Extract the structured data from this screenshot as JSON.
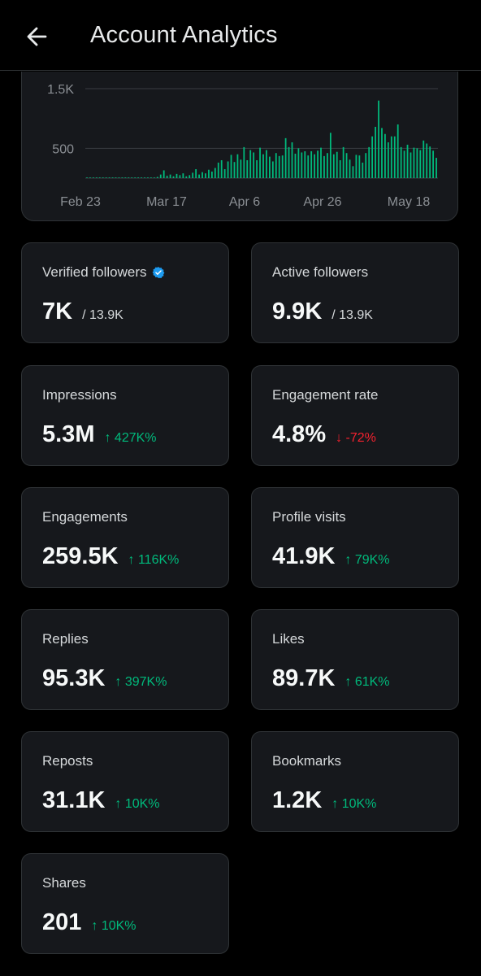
{
  "header": {
    "title": "Account Analytics",
    "back_icon": "arrow-left-icon"
  },
  "chart_data": {
    "type": "bar",
    "ylim": [
      0,
      1500
    ],
    "y_ticks": [
      {
        "value": 500,
        "label": "500"
      },
      {
        "value": 1500,
        "label": "1.5K"
      }
    ],
    "x_ticks": [
      "Feb 23",
      "Mar 17",
      "Apr 6",
      "Apr 26",
      "May 18"
    ],
    "x": [
      "Feb 23",
      "Feb 24",
      "Feb 25",
      "Feb 26",
      "Feb 27",
      "Feb 28",
      "Feb 29",
      "Mar 1",
      "Mar 2",
      "Mar 3",
      "Mar 4",
      "Mar 5",
      "Mar 6",
      "Mar 7",
      "Mar 8",
      "Mar 9",
      "Mar 10",
      "Mar 11",
      "Mar 12",
      "Mar 13",
      "Mar 14",
      "Mar 15",
      "Mar 16",
      "Mar 17",
      "Mar 18",
      "Mar 19",
      "Mar 20",
      "Mar 21",
      "Mar 22",
      "Mar 23",
      "Mar 24",
      "Mar 25",
      "Mar 26",
      "Mar 27",
      "Mar 28",
      "Mar 29",
      "Mar 30",
      "Mar 31",
      "Apr 1",
      "Apr 2",
      "Apr 3",
      "Apr 4",
      "Apr 5",
      "Apr 6",
      "Apr 7",
      "Apr 8",
      "Apr 9",
      "Apr 10",
      "Apr 11",
      "Apr 12",
      "Apr 13",
      "Apr 14",
      "Apr 15",
      "Apr 16",
      "Apr 17",
      "Apr 18",
      "Apr 19",
      "Apr 20",
      "Apr 21",
      "Apr 22",
      "Apr 23",
      "Apr 24",
      "Apr 25",
      "Apr 26",
      "Apr 27",
      "Apr 28",
      "Apr 29",
      "Apr 30",
      "May 1",
      "May 2",
      "May 3",
      "May 4",
      "May 5",
      "May 6",
      "May 7",
      "May 8",
      "May 9",
      "May 10",
      "May 11",
      "May 12",
      "May 13",
      "May 14",
      "May 15",
      "May 16",
      "May 17",
      "May 18",
      "May 19",
      "May 20",
      "May 21",
      "May 22",
      "May 23"
    ],
    "values": [
      5,
      5,
      5,
      5,
      5,
      5,
      5,
      5,
      5,
      5,
      5,
      5,
      5,
      5,
      5,
      5,
      5,
      5,
      5,
      5,
      5,
      5,
      20,
      60,
      130,
      40,
      60,
      30,
      70,
      50,
      80,
      30,
      50,
      90,
      150,
      60,
      100,
      80,
      140,
      110,
      170,
      260,
      300,
      150,
      280,
      390,
      270,
      400,
      310,
      520,
      300,
      470,
      430,
      300,
      510,
      400,
      470,
      360,
      280,
      420,
      370,
      380,
      670,
      520,
      600,
      410,
      500,
      430,
      450,
      380,
      450,
      400,
      460,
      510,
      370,
      420,
      760,
      400,
      440,
      300,
      520,
      420,
      310,
      200,
      390,
      380,
      260,
      420,
      520,
      700,
      860,
      1300,
      840,
      740,
      600,
      700,
      700,
      900,
      520,
      460,
      560,
      430,
      510,
      500,
      470,
      630,
      580,
      530,
      460,
      340
    ]
  },
  "stats": [
    {
      "label": "Verified followers",
      "value": "7K",
      "sub": "/ 13.9K",
      "verified": true
    },
    {
      "label": "Active followers",
      "value": "9.9K",
      "sub": "/ 13.9K"
    },
    {
      "label": "Impressions",
      "value": "5.3M",
      "change": "↑ 427K%",
      "dir": "up"
    },
    {
      "label": "Engagement rate",
      "value": "4.8%",
      "change": "↓ -72%",
      "dir": "down"
    },
    {
      "label": "Engagements",
      "value": "259.5K",
      "change": "↑ 116K%",
      "dir": "up"
    },
    {
      "label": "Profile visits",
      "value": "41.9K",
      "change": "↑ 79K%",
      "dir": "up"
    },
    {
      "label": "Replies",
      "value": "95.3K",
      "change": "↑ 397K%",
      "dir": "up"
    },
    {
      "label": "Likes",
      "value": "89.7K",
      "change": "↑ 61K%",
      "dir": "up"
    },
    {
      "label": "Reposts",
      "value": "31.1K",
      "change": "↑ 10K%",
      "dir": "up"
    },
    {
      "label": "Bookmarks",
      "value": "1.2K",
      "change": "↑ 10K%",
      "dir": "up"
    },
    {
      "label": "Shares",
      "value": "201",
      "change": "↑ 10K%",
      "dir": "up"
    }
  ],
  "colors": {
    "bar": "#00ba7c",
    "up": "#00ba7c",
    "down": "#f4212e",
    "verified": "#1d9bf0"
  }
}
